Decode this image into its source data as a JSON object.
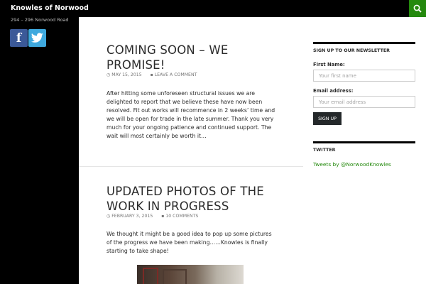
{
  "header": {
    "site_title": "Knowles of Norwood",
    "search_icon": "search-icon"
  },
  "left_sidebar": {
    "tagline": "294 – 296 Norwood Road",
    "social": [
      {
        "name": "facebook",
        "icon": "facebook-icon",
        "glyph": "f",
        "color": "#3b5998"
      },
      {
        "name": "twitter",
        "icon": "twitter-icon",
        "color": "#3fa9de"
      }
    ]
  },
  "posts": [
    {
      "title": "COMING SOON – WE PROMISE!",
      "date": "MAY 15, 2015",
      "comments": "LEAVE A COMMENT",
      "excerpt": "After hitting some unforeseen structural issues we are delighted to report that we believe these have now been resolved. Fit out works will recommence in 2 weeks’ time and we will be open for trade in the late summer. Thank you very much for your ongoing patience and continued support. The wait will most certainly be worth it…"
    },
    {
      "title": "UPDATED PHOTOS OF THE WORK IN PROGRESS",
      "date": "FEBRUARY 3, 2015",
      "comments": "10 COMMENTS",
      "excerpt": "We thought it might be a good idea to pop up some pictures of the progress we have been making……Knowles is finally starting to take shape!"
    }
  ],
  "newsletter": {
    "title": "SIGN UP TO OUR NEWSLETTER",
    "first_name_label": "First Name:",
    "first_name_placeholder": "Your first name",
    "email_label": "Email address:",
    "email_placeholder": "Your email address",
    "button": "SIGN UP"
  },
  "twitter": {
    "title": "TWITTER",
    "link": "Tweets by @NorwoodKnowles"
  },
  "colors": {
    "accent": "#24890d",
    "dark": "#000000"
  }
}
